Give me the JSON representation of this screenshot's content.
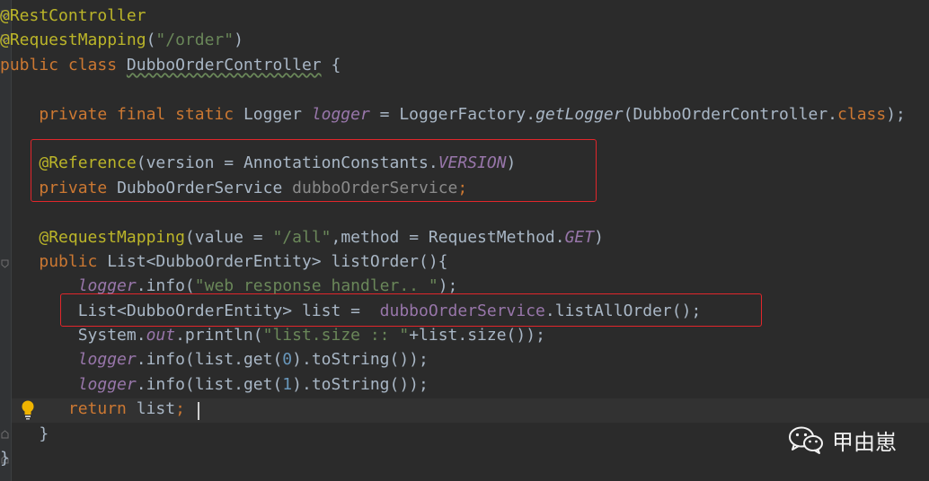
{
  "code_lines": [
    [
      {
        "t": "@RestController",
        "c": "anno"
      }
    ],
    [
      {
        "t": "@RequestMapping",
        "c": "anno"
      },
      {
        "t": "("
      },
      {
        "t": "\"/order\"",
        "c": "str"
      },
      {
        "t": ")"
      }
    ],
    [
      {
        "t": "public class ",
        "c": "kw"
      },
      {
        "t": "DubboOrderController",
        "c": "squig"
      },
      {
        "t": " {"
      }
    ],
    [],
    [
      {
        "t": "    "
      },
      {
        "t": "private final static ",
        "c": "kw"
      },
      {
        "t": "Logger "
      },
      {
        "t": "logger",
        "c": "sfld"
      },
      {
        "t": " = LoggerFactory."
      },
      {
        "t": "getLogger",
        "c": "ital"
      },
      {
        "t": "(DubboOrderController."
      },
      {
        "t": "class",
        "c": "kw"
      },
      {
        "t": ");"
      }
    ],
    [],
    [
      {
        "t": "    "
      },
      {
        "t": "@Reference",
        "c": "anno"
      },
      {
        "t": "(version = AnnotationConstants."
      },
      {
        "t": "VERSION",
        "c": "sfld"
      },
      {
        "t": ")"
      }
    ],
    [
      {
        "t": "    "
      },
      {
        "t": "private ",
        "c": "kw"
      },
      {
        "t": "DubboOrderService "
      },
      {
        "t": "dubboOrderService",
        "c": "dim"
      },
      {
        "t": ";",
        "c": "kw"
      }
    ],
    [],
    [
      {
        "t": "    "
      },
      {
        "t": "@RequestMapping",
        "c": "anno"
      },
      {
        "t": "(value = "
      },
      {
        "t": "\"/all\"",
        "c": "str"
      },
      {
        "t": ","
      },
      {
        "t": "method = RequestMethod."
      },
      {
        "t": "GET",
        "c": "sfld"
      },
      {
        "t": ")"
      }
    ],
    [
      {
        "t": "    "
      },
      {
        "t": "public ",
        "c": "kw"
      },
      {
        "t": "List<DubboOrderEntity> listOrder(){"
      }
    ],
    [
      {
        "t": "        "
      },
      {
        "t": "logger",
        "c": "sfld"
      },
      {
        "t": ".info("
      },
      {
        "t": "\"web response handler.. \"",
        "c": "str"
      },
      {
        "t": ");"
      }
    ],
    [
      {
        "t": "        "
      },
      {
        "t": "List<DubboOrderEntity> list =  "
      },
      {
        "t": "dubboOrderService",
        "c": "fld"
      },
      {
        "t": ".listAllOrder();"
      }
    ],
    [
      {
        "t": "        "
      },
      {
        "t": "System."
      },
      {
        "t": "out",
        "c": "sfld"
      },
      {
        "t": ".println("
      },
      {
        "t": "\"list.size :: \"",
        "c": "str"
      },
      {
        "t": "+list.size());"
      }
    ],
    [
      {
        "t": "        "
      },
      {
        "t": "logger",
        "c": "sfld"
      },
      {
        "t": ".info(list.get("
      },
      {
        "t": "0",
        "c": "num"
      },
      {
        "t": ").toString());"
      }
    ],
    [
      {
        "t": "        "
      },
      {
        "t": "logger",
        "c": "sfld"
      },
      {
        "t": ".info(list.get("
      },
      {
        "t": "1",
        "c": "num"
      },
      {
        "t": ").toString());"
      }
    ],
    [
      {
        "t": "       "
      },
      {
        "t": "return ",
        "c": "kw"
      },
      {
        "t": "list"
      },
      {
        "t": ";",
        "c": "kw"
      }
    ],
    [
      {
        "t": "    }"
      }
    ],
    [
      {
        "t": "}"
      }
    ]
  ],
  "watermark": {
    "text": "甲由崽",
    "icon": "wechat-icon"
  },
  "colors": {
    "background": "#2b2b2b",
    "keyword": "#cc7832",
    "annotation": "#bbb529",
    "string": "#6a8759",
    "field": "#9876aa",
    "number": "#6897bb",
    "default": "#a9b7c6",
    "highlight_box": "#e2262b"
  }
}
